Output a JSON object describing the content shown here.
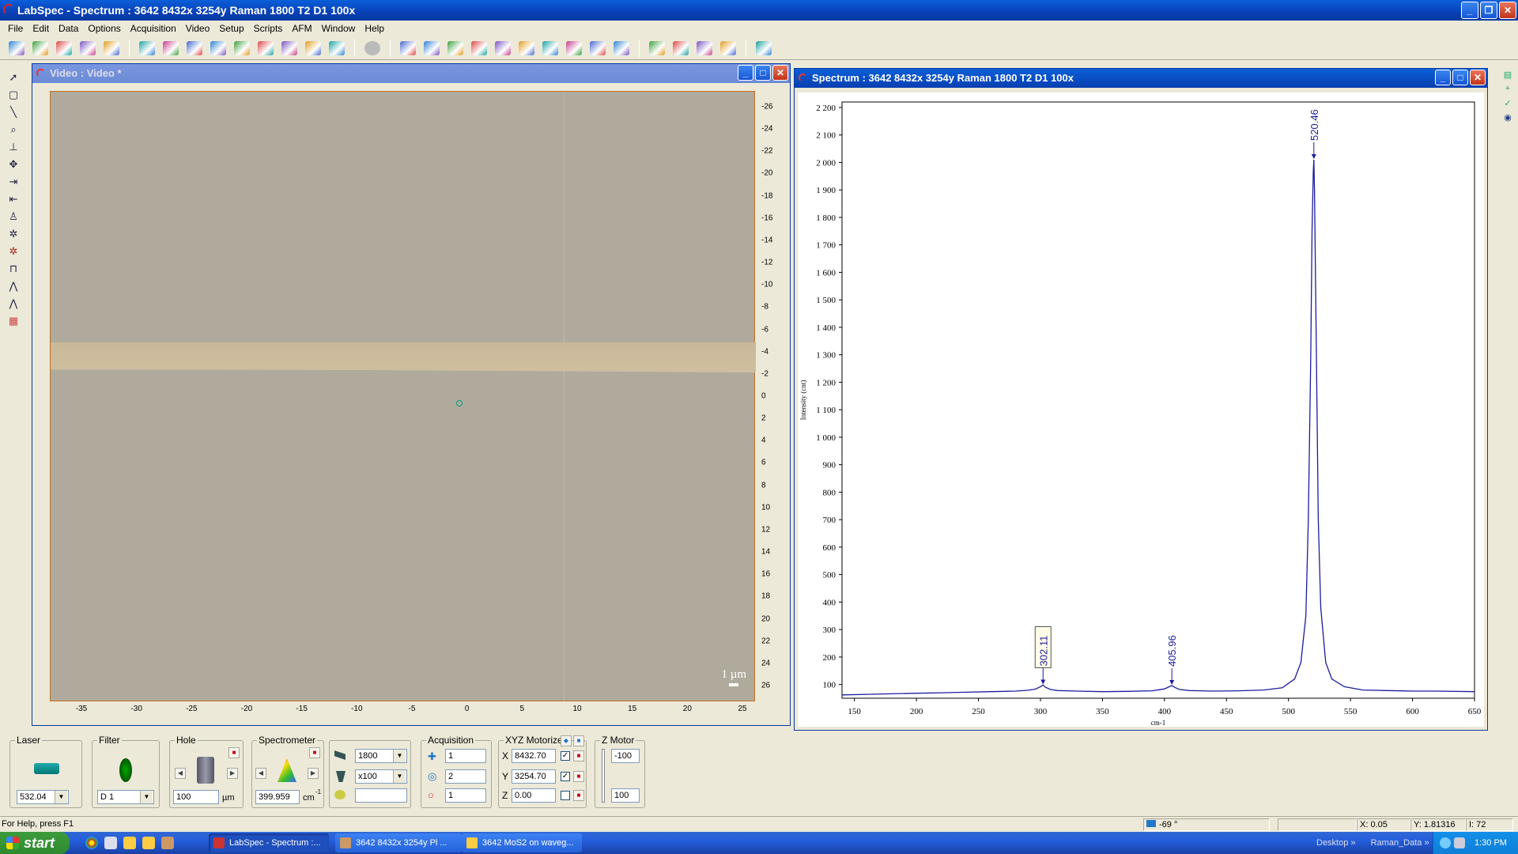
{
  "app": {
    "title": "LabSpec - Spectrum : 3642 8432x 3254y Raman 1800 T2 D1 100x"
  },
  "menu": [
    "File",
    "Edit",
    "Data",
    "Options",
    "Acquisition",
    "Video",
    "Setup",
    "Scripts",
    "AFM",
    "Window",
    "Help"
  ],
  "toolbar_icons": [
    "visualization-icon",
    "spectrum-icon",
    "multi-icon",
    "image-icon",
    "info-icon",
    "map-icon",
    "grid-icon",
    "pick-icon",
    "cube-icon",
    "matrix-icon",
    "graph-icon",
    "sphere-icon",
    "fit-icon",
    "peak-icon",
    "stop-icon",
    "spectra-icon",
    "peaks-icon",
    "baseline-icon",
    "smooth-icon",
    "points-icon",
    "bars-icon",
    "export-icon",
    "layers-icon",
    "palette-icon",
    "trend-icon",
    "open-icon",
    "save-icon",
    "print-icon",
    "help-icon",
    "basket-icon"
  ],
  "video": {
    "title": "Video : Video *",
    "scale_label": "1 µm",
    "y_ticks": [
      "-26",
      "-24",
      "-22",
      "-20",
      "-18",
      "-16",
      "-14",
      "-12",
      "-10",
      "-8",
      "-6",
      "-4",
      "-2",
      "0",
      "2",
      "4",
      "6",
      "8",
      "10",
      "12",
      "14",
      "16",
      "18",
      "20",
      "22",
      "24",
      "26"
    ],
    "x_ticks": [
      "-35",
      "-30",
      "-25",
      "-20",
      "-15",
      "-10",
      "-5",
      "0",
      "5",
      "10",
      "15",
      "20",
      "25"
    ]
  },
  "spectrum": {
    "title": "Spectrum : 3642 8432x 3254y Raman 1800 T2 D1 100x",
    "peak_labels": [
      {
        "label": "302.11",
        "x": 302.11,
        "boxed": true
      },
      {
        "label": "405.96",
        "x": 405.96,
        "boxed": false
      },
      {
        "label": "520.46",
        "x": 520.46,
        "boxed": false
      }
    ]
  },
  "chart_data": {
    "type": "line",
    "title": "",
    "xlabel": "cm-1",
    "ylabel": "Intensity (cnt)",
    "xlim": [
      140,
      650
    ],
    "ylim": [
      50,
      2220
    ],
    "x_ticks": [
      150,
      200,
      250,
      300,
      350,
      400,
      450,
      500,
      550,
      600,
      650
    ],
    "y_ticks": [
      100,
      200,
      300,
      400,
      500,
      600,
      700,
      800,
      900,
      1000,
      1100,
      1200,
      1300,
      1400,
      1500,
      1600,
      1700,
      1800,
      1900,
      2000,
      2100,
      2200
    ],
    "y_tick_labels": [
      "100",
      "200",
      "300",
      "400",
      "500",
      "600",
      "700",
      "800",
      "900",
      "1 000",
      "1 100",
      "1 200",
      "1 300",
      "1 400",
      "1 500",
      "1 600",
      "1 700",
      "1 800",
      "1 900",
      "2 000",
      "2 100",
      "2 200"
    ],
    "series": [
      {
        "color": "#1c1ca0",
        "x": [
          140,
          160,
          180,
          200,
          220,
          240,
          260,
          280,
          290,
          296,
          300,
          302,
          304,
          308,
          314,
          330,
          350,
          370,
          390,
          400,
          404,
          406,
          408,
          412,
          420,
          440,
          460,
          480,
          495,
          505,
          510,
          514,
          516,
          518,
          519,
          520,
          520.46,
          521,
          522,
          524,
          526,
          530,
          535,
          545,
          560,
          580,
          600,
          620,
          650
        ],
        "y": [
          62,
          64,
          66,
          68,
          70,
          72,
          74,
          76,
          79,
          83,
          92,
          98,
          90,
          82,
          78,
          76,
          74,
          75,
          77,
          84,
          92,
          96,
          90,
          82,
          78,
          76,
          77,
          80,
          88,
          120,
          180,
          350,
          700,
          1300,
          1750,
          1970,
          2010,
          1900,
          1500,
          700,
          380,
          180,
          120,
          92,
          80,
          78,
          76,
          76,
          74
        ]
      }
    ]
  },
  "panel": {
    "laser": {
      "label": "Laser",
      "value": "532.04"
    },
    "filter": {
      "label": "Filter",
      "value": "D 1"
    },
    "hole": {
      "label": "Hole",
      "value": "100",
      "unit": "µm"
    },
    "spectrometer": {
      "label": "Spectrometer",
      "value": "399.959",
      "unit": "cm",
      "sup": "-1"
    },
    "grating": {
      "value": "1800"
    },
    "objective": {
      "value": "x100"
    },
    "acquisition": {
      "label": "Acquisition",
      "time": "1",
      "accum": "2",
      "repeat": "1"
    },
    "xyz": {
      "label": "XYZ Motorized",
      "x_label": "X",
      "x": "8432.70",
      "y_label": "Y",
      "y": "3254.70",
      "z_label": "Z",
      "z": "0.00"
    },
    "zmotor": {
      "label": "Z Motor",
      "top": "-100",
      "bottom": "100"
    }
  },
  "status": {
    "help": "For Help, press F1",
    "temp": "-69 °",
    "x": "X: 0.05",
    "y": "Y: 1.81316",
    "i": "I: 72"
  },
  "taskbar": {
    "start": "start",
    "tasks": [
      "LabSpec - Spectrum :...",
      "3642 8432x 3254y Pl ...",
      "3642 MoS2 on waveg..."
    ],
    "links": [
      "Desktop",
      "»",
      "Raman_Data",
      "»"
    ],
    "time": "1:30 PM"
  }
}
